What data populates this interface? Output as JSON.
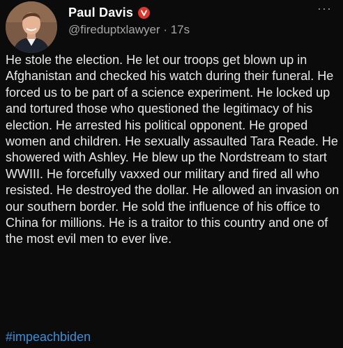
{
  "post": {
    "author_name": "Paul Davis",
    "verified_badge_icon": "verified-v-badge-icon",
    "more_icon": "more-options-icon",
    "more_glyph": "···",
    "handle": "@fireduptxlawyer",
    "separator": " · ",
    "time_ago": "17s",
    "body": "He stole the election. He let our troops get blown up in Afghanistan and checked his watch during their funeral. He forced us to be part of a science experiment. He locked up and tortured those who questioned the legitimacy of his election. He arrested his political opponent. He groped women and children. He sexually assaulted Tara Reade. He showered with Ashley. He blew up the Nordstream to start WWIII. He forcefully vaxxed our military and fired all who resisted. He destroyed the dollar. He allowed an invasion on our southern border. He sold the influence of his office to China for millions. He is a traitor to this country and one of the most evil men to ever live.",
    "hashtag": "#impeachbiden"
  },
  "colors": {
    "background": "#0b0b0b",
    "text": "#e8e8e8",
    "secondary_text": "#a7a7a7",
    "link": "#3b8fd9",
    "badge": "#e0352b"
  }
}
